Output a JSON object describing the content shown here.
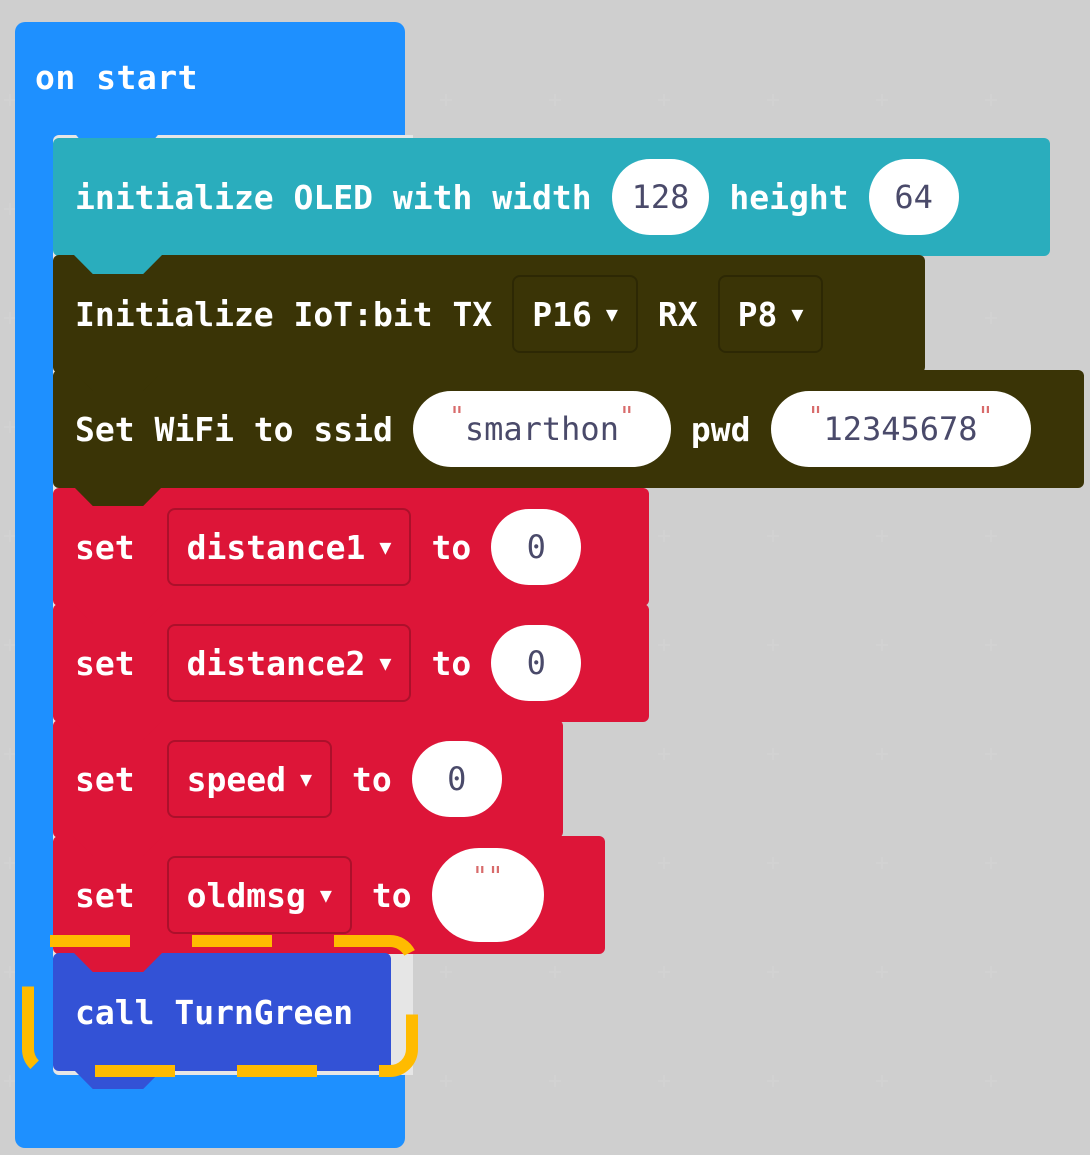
{
  "hat": {
    "label": "on start"
  },
  "oled": {
    "prefix": "initialize OLED with width",
    "width": "128",
    "height_label": "height",
    "height": "64"
  },
  "iot": {
    "prefix": "Initialize IoT:bit TX",
    "tx": "P16",
    "rx_label": "RX",
    "rx": "P8"
  },
  "wifi": {
    "prefix": "Set WiFi to ssid",
    "ssid": "smarthon",
    "pwd_label": "pwd",
    "pwd": "12345678"
  },
  "sets": [
    {
      "set_label": "set",
      "var": "distance1",
      "to_label": "to",
      "value": "0"
    },
    {
      "set_label": "set",
      "var": "distance2",
      "to_label": "to",
      "value": "0"
    },
    {
      "set_label": "set",
      "var": "speed",
      "to_label": "to",
      "value": "0"
    },
    {
      "set_label": "set",
      "var": "oldmsg",
      "to_label": "to",
      "value": ""
    }
  ],
  "call": {
    "label": "call TurnGreen"
  },
  "colors": {
    "hat": "#1e90ff",
    "oled": "#2aadbd",
    "iot": "#3a3406",
    "variables": "#dd1538",
    "functions": "#3352d6",
    "highlight": "#ffbb00"
  }
}
